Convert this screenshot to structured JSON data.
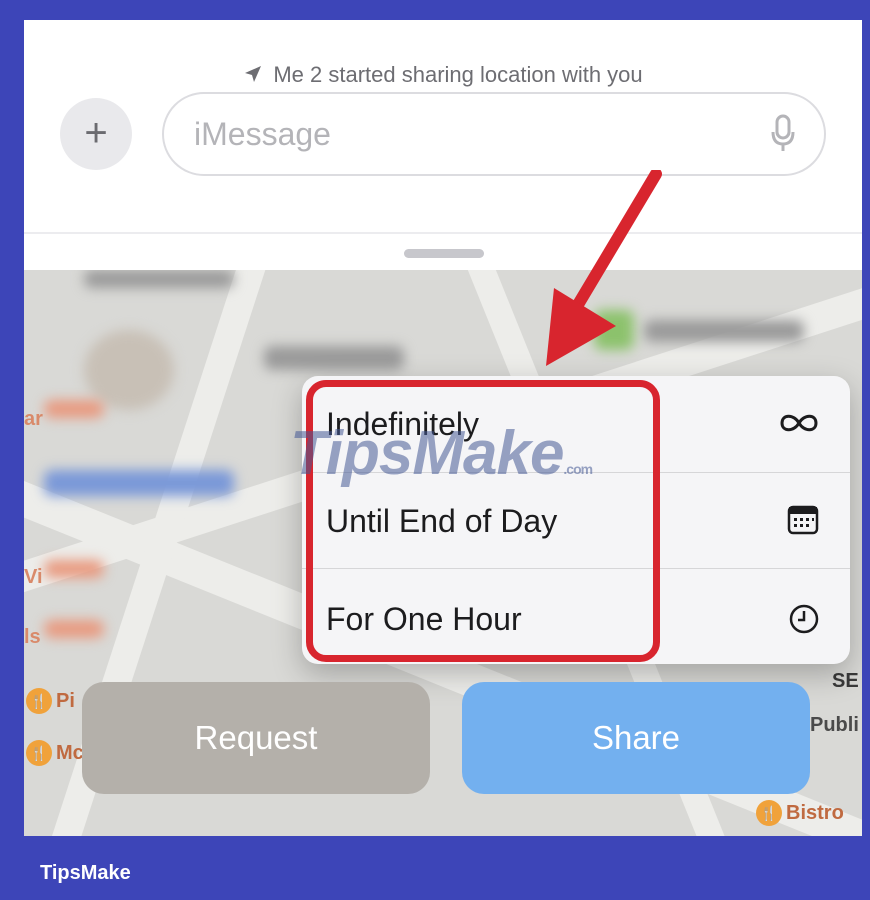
{
  "messages": {
    "share_notice": "Me 2 started sharing location with you",
    "input_placeholder": "iMessage"
  },
  "duration_menu": {
    "items": [
      {
        "label": "Indefinitely",
        "icon": "infinity-icon"
      },
      {
        "label": "Until End of Day",
        "icon": "calendar-icon"
      },
      {
        "label": "For One Hour",
        "icon": "clock-icon"
      }
    ]
  },
  "actions": {
    "request_label": "Request",
    "share_label": "Share"
  },
  "map_labels": {
    "bistro": "Bistro",
    "se": "SE",
    "publi": "Publi",
    "pi": "Pi",
    "mc": "Mc",
    "ar": "ar",
    "vi": "Vi",
    "ls": "ls"
  },
  "watermark": {
    "text": "TipsMake",
    "suffix": ".com"
  },
  "footer": {
    "brand": "TipsMake"
  },
  "colors": {
    "frame_border": "#3d45b8",
    "highlight": "#d8252e",
    "share_button": "#73b0ef",
    "request_button": "#b4b0aa"
  }
}
